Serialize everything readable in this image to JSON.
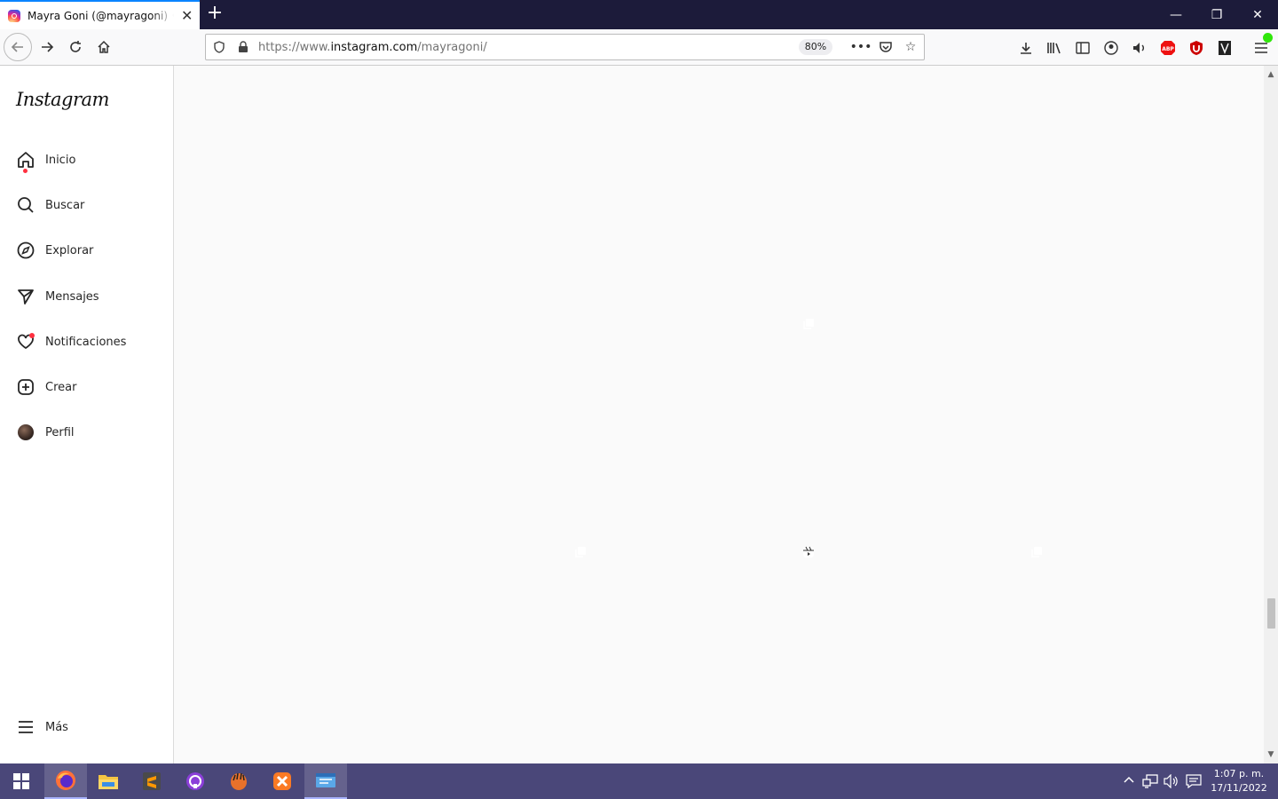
{
  "browser": {
    "tab_title": "Mayra Goni (@mayragoni) • Fotos y videos de Instagram",
    "url_prefix": "https://www.",
    "url_domain": "instagram.com",
    "url_path": "/mayragoni/",
    "zoom": "80%"
  },
  "sidebar": {
    "logo": "Instagram",
    "items": [
      {
        "label": "Inicio",
        "icon": "home-icon"
      },
      {
        "label": "Buscar",
        "icon": "search-icon"
      },
      {
        "label": "Explorar",
        "icon": "compass-icon"
      },
      {
        "label": "Mensajes",
        "icon": "messenger-icon"
      },
      {
        "label": "Notificaciones",
        "icon": "heart-icon"
      },
      {
        "label": "Crear",
        "icon": "plus-square-icon"
      },
      {
        "label": "Perfil",
        "icon": "avatar"
      }
    ],
    "more": "Más"
  },
  "posts": [
    {
      "badge": "",
      "colors": [
        "#d9dde0",
        "#a9b0b3",
        "#c98b9d"
      ]
    },
    {
      "badge": "",
      "colors": [
        "#5a4a3c",
        "#c8b89a",
        "#4f5a3a"
      ]
    },
    {
      "badge": "",
      "colors": [
        "#2a3a6a",
        "#c2534a",
        "#8aa0b0"
      ]
    },
    {
      "badge": "",
      "colors": [
        "#c8c6c4",
        "#3a2e28",
        "#2a221e"
      ]
    },
    {
      "badge": "carousel-icon",
      "colors": [
        "#d8d4d0",
        "#2a2624",
        "#8a7a70"
      ]
    },
    {
      "badge": "",
      "colors": [
        "#c8d0d6",
        "#8a8070",
        "#6a80a6"
      ]
    },
    {
      "badge": "carousel-icon",
      "colors": [
        "#e8eef0",
        "#6a8a5a",
        "#1a1a1a"
      ]
    },
    {
      "badge": "reel-icon",
      "colors": [
        "#e6e6e6",
        "#f2f2f2",
        "#8a6a50"
      ]
    },
    {
      "badge": "carousel-icon",
      "colors": [
        "#b8c8d6",
        "#5a4a3a",
        "#f0ece8"
      ]
    }
  ],
  "taskbar": {
    "apps": [
      "windows-start-icon",
      "firefox-icon",
      "file-explorer-icon",
      "sublime-text-icon",
      "github-desktop-icon",
      "app-icon",
      "xampp-icon",
      "app-window-icon"
    ],
    "time": "1:07 p. m.",
    "date": "17/11/2022"
  }
}
